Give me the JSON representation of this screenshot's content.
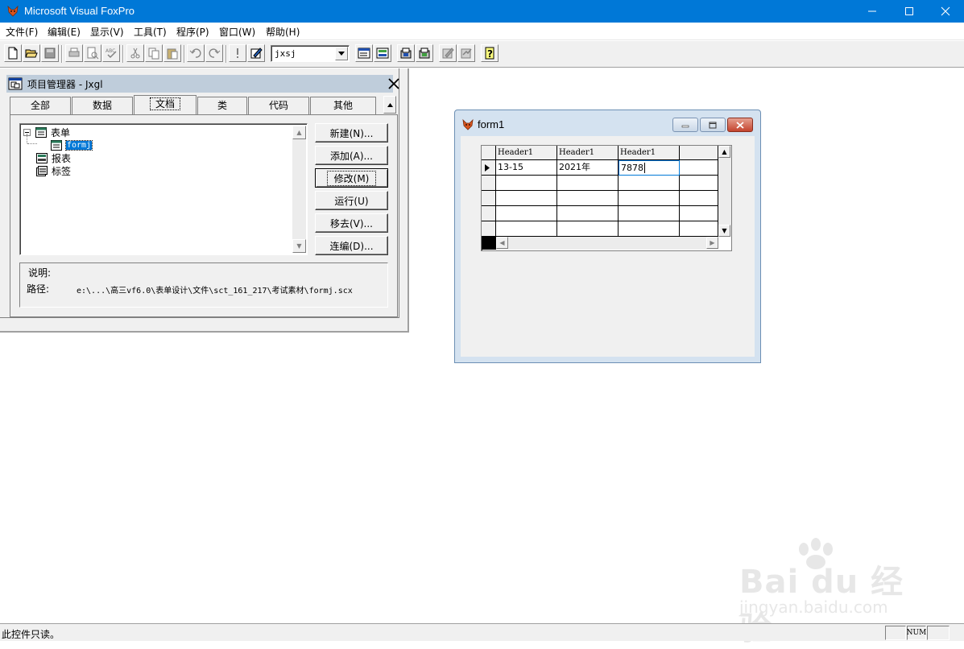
{
  "app": {
    "title": "Microsoft Visual FoxPro"
  },
  "menu": [
    "文件(F)",
    "编辑(E)",
    "显示(V)",
    "工具(T)",
    "程序(P)",
    "窗口(W)",
    "帮助(H)"
  ],
  "toolbar": {
    "database_combo": "jxsj"
  },
  "project_manager": {
    "title": "项目管理器 - Jxgl",
    "tabs": [
      "全部",
      "数据",
      "文档",
      "类",
      "代码",
      "其他"
    ],
    "active_tab": "文档",
    "tree": {
      "forms": "表单",
      "selected_form": "formj",
      "reports": "报表",
      "labels": "标签"
    },
    "buttons": {
      "new": "新建(N)...",
      "add": "添加(A)...",
      "modify": "修改(M)",
      "run": "运行(U)",
      "remove": "移去(V)...",
      "build": "连编(D)..."
    },
    "desc_label": "说明:",
    "path_label": "路径:",
    "path_value": "e:\\...\\高三vf6.0\\表单设计\\文件\\sct_161_217\\考试素材\\formj.scx"
  },
  "form1": {
    "title": "form1",
    "grid": {
      "headers": [
        "Header1",
        "Header1",
        "Header1"
      ],
      "row1": [
        "13-15",
        "2021年",
        "7878"
      ]
    }
  },
  "statusbar": {
    "message": "此控件只读。",
    "num": "NUM"
  },
  "watermark": {
    "main": "Bai du 经验",
    "sub": "jingyan.baidu.com"
  }
}
